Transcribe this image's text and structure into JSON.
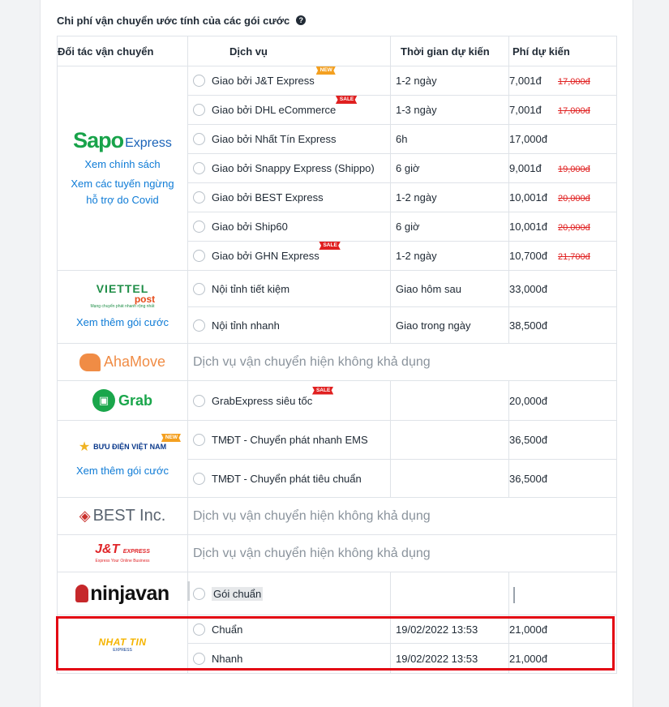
{
  "title": "Chi phí vận chuyển ước tính của các gói cước",
  "headers": {
    "partner": "Đối tác vận chuyển",
    "service": "Dịch vụ",
    "time": "Thời gian dự kiến",
    "fee": "Phí dự kiến"
  },
  "unavailable_text": "Dịch vụ vận chuyển hiện không khả dụng",
  "sapo": {
    "logo_main": "Sapo",
    "logo_sub": "Express",
    "link_policy": "Xem chính sách",
    "link_covid": "Xem các tuyến ngừng hỗ trợ do Covid",
    "services": [
      {
        "name": "Giao bởi J&T Express",
        "badge": "NEW",
        "time": "1-2 ngày",
        "price": "7,001đ",
        "old": "17,000đ"
      },
      {
        "name": "Giao bởi DHL eCommerce",
        "badge": "SALE",
        "time": "1-3 ngày",
        "price": "7,001đ",
        "old": "17,000đ"
      },
      {
        "name": "Giao bởi Nhất Tín Express",
        "badge": "",
        "time": "6h",
        "price": "17,000đ",
        "old": ""
      },
      {
        "name": "Giao bởi Snappy Express (Shippo)",
        "badge": "",
        "time": "6 giờ",
        "price": "9,001đ",
        "old": "19,000đ"
      },
      {
        "name": "Giao bởi BEST Express",
        "badge": "",
        "time": "1-2 ngày",
        "price": "10,001đ",
        "old": "20,000đ"
      },
      {
        "name": "Giao bởi Ship60",
        "badge": "",
        "time": "6 giờ",
        "price": "10,001đ",
        "old": "20,000đ"
      },
      {
        "name": "Giao bởi GHN Express",
        "badge": "SALE",
        "time": "1-2 ngày",
        "price": "10,700đ",
        "old": "21,700đ"
      }
    ]
  },
  "viettel": {
    "logo_top": "VIETTEL",
    "logo_post": "post",
    "logo_tag": "Mạng chuyển phát nhanh rộng nhất",
    "link": "Xem thêm gói cước",
    "services": [
      {
        "name": "Nội tỉnh tiết kiệm",
        "time": "Giao hôm sau",
        "price": "33,000đ"
      },
      {
        "name": "Nội tỉnh nhanh",
        "time": "Giao trong ngày",
        "price": "38,500đ"
      }
    ]
  },
  "ahamove": {
    "logo": "AhaMove"
  },
  "grab": {
    "logo": "Grab",
    "service": {
      "name": "GrabExpress siêu tốc",
      "badge": "SALE",
      "price": "20,000đ"
    }
  },
  "vnpost": {
    "logo": "BƯU ĐIỆN VIỆT NAM",
    "badge": "NEW",
    "link": "Xem thêm gói cước",
    "services": [
      {
        "name": "TMĐT - Chuyển phát nhanh EMS",
        "price": "36,500đ"
      },
      {
        "name": "TMĐT - Chuyển phát tiêu chuẩn",
        "price": "36,500đ"
      }
    ]
  },
  "best": {
    "logo": "BEST Inc."
  },
  "jt": {
    "logo": "J&T",
    "logo_express": "EXPRESS",
    "logo_sub": "Express Your Online Business"
  },
  "ninjavan": {
    "logo": "ninjavan",
    "service": "Gói chuẩn"
  },
  "nhattin": {
    "logo": "NHAT TIN",
    "logo_sub": "EXPRESS",
    "services": [
      {
        "name": "Chuẩn",
        "time": "19/02/2022 13:53",
        "price": "21,000đ"
      },
      {
        "name": "Nhanh",
        "time": "19/02/2022 13:53",
        "price": "21,000đ"
      }
    ]
  },
  "colors": {
    "link": "#0e7bd6",
    "sale": "#e02020",
    "new": "#f4a020",
    "highlight": "#e30613"
  }
}
